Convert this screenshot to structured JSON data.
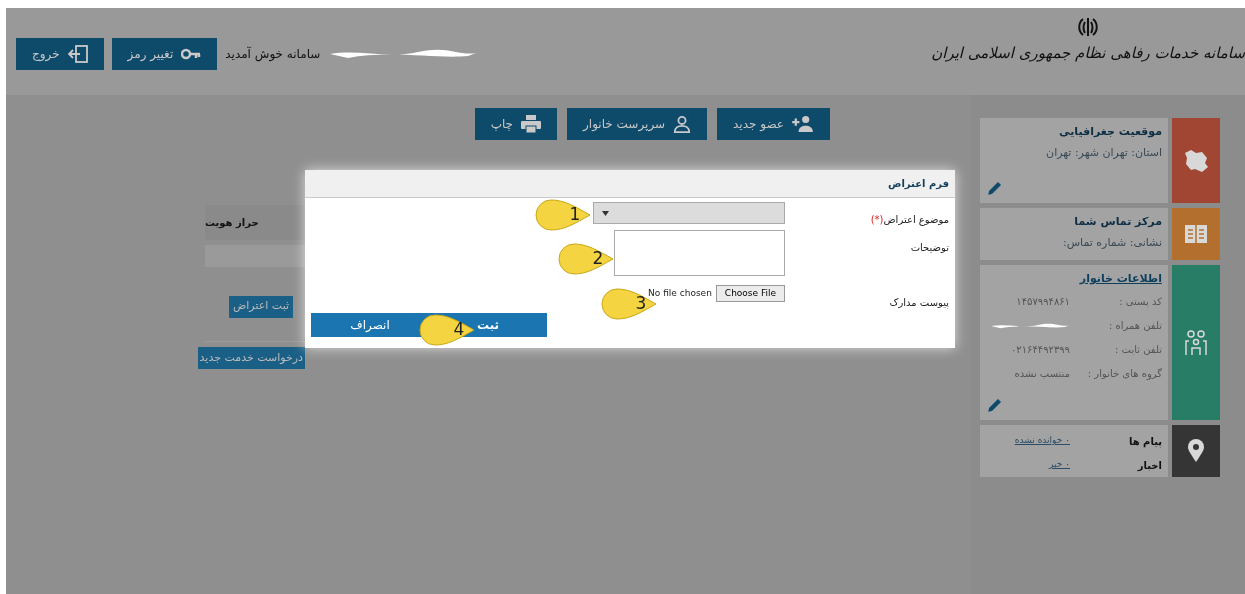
{
  "header": {
    "title": "سامانه خدمات رفاهی نظام جمهوری اسلامی ایران",
    "welcome": "سامانه خوش آمدید",
    "buttons": [
      {
        "kind": "password",
        "label": "تغییر رمز"
      },
      {
        "kind": "logout",
        "label": "خروج"
      }
    ]
  },
  "toolbar": [
    {
      "kind": "add-member",
      "label": "عضو جدید"
    },
    {
      "kind": "head",
      "label": "سرپرست خانوار"
    },
    {
      "kind": "print",
      "label": "چاپ"
    }
  ],
  "background_table": {
    "header": "حراز هویت",
    "row_button": "ثبت اعتراض",
    "new_request_button": "درخواست خدمت جدید"
  },
  "modal": {
    "title": "فرم اعتراض",
    "fields": [
      {
        "kind": "select",
        "label": "موضوع اعتراض",
        "required_mark": "(*)",
        "callout": "1"
      },
      {
        "kind": "textarea",
        "label": "توضیحات",
        "callout": "2"
      },
      {
        "kind": "file",
        "label": "پیوست مدارک",
        "file_button": "Choose File",
        "file_status": "No file chosen",
        "callout": "3"
      }
    ],
    "submit": {
      "label": "ثبت",
      "callout": "4"
    },
    "cancel": {
      "label": "انصراف"
    }
  },
  "sidebar": [
    {
      "kind": "location",
      "color": "#a24634",
      "title": "موقعیت جغرافیایی",
      "text": "استان: تهران شهر: تهران",
      "editable": true
    },
    {
      "kind": "contact",
      "color": "#b26f2d",
      "title": "مرکز تماس شما",
      "text": "نشانی: شماره تماس:",
      "editable": false
    },
    {
      "kind": "family",
      "color": "#287d66",
      "title": "اطلاعات خانوار",
      "rows": [
        {
          "label": "کد پستی :",
          "value": "۱۴۵۷۹۹۴۸۶۱"
        },
        {
          "label": "تلفن همراه :"
        },
        {
          "label": "تلفن ثابت :",
          "value": "۰۲۱۶۴۴۹۲۳۹۹"
        },
        {
          "label": "گروه های خانوار :",
          "value": "منتسب نشده"
        }
      ],
      "editable": true
    },
    {
      "kind": "messages",
      "color": "#353535",
      "rows": [
        {
          "label": "پیام ها",
          "value": "۰ خوانده نشده"
        },
        {
          "label": "اخبار",
          "value": "۰ خبر"
        }
      ]
    }
  ]
}
